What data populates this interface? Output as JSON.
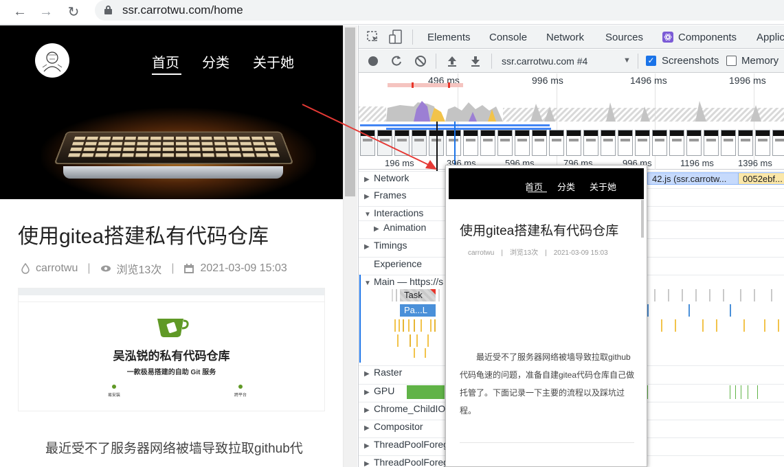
{
  "browser": {
    "back_glyph": "←",
    "forward_glyph": "→",
    "reload_glyph": "↻",
    "url": "ssr.carrotwu.com/home"
  },
  "webpage": {
    "nav": [
      "首页",
      "分类",
      "关于她"
    ],
    "post_title": "使用gitea搭建私有代码仓库",
    "meta": {
      "author": "carrotwu",
      "views": "浏览13次",
      "date": "2021-03-09 15:03",
      "separator": "|"
    },
    "screenshot": {
      "title": "吴泓锐的私有代码仓库",
      "subtitle": "一款极易搭建的自助 Git 服务",
      "feature_left_title": "易安装",
      "feature_right_title": "跨平台"
    },
    "body_first_line": "最近受不了服务器网络被墙导致拉取github代"
  },
  "devtools": {
    "tabs": [
      "Elements",
      "Console",
      "Network",
      "Sources",
      "Components",
      "Applic"
    ],
    "toolbar": {
      "profile_select": "ssr.carrotwu.com #4",
      "dropdown_glyph": "▼",
      "screenshots_label": "Screenshots",
      "screenshots_checked": true,
      "memory_label": "Memory",
      "memory_checked": false
    },
    "overview_ticks": [
      "496 ms",
      "996 ms",
      "1496 ms",
      "1996 ms"
    ],
    "ruler_ticks": [
      "196 ms",
      "396 ms",
      "596 ms",
      "796 ms",
      "996 ms",
      "1196 ms",
      "1396 ms"
    ],
    "tracks": [
      {
        "label": "Network",
        "expanded": false
      },
      {
        "label": "Frames",
        "expanded": false
      },
      {
        "label": "Interactions",
        "expanded": true
      },
      {
        "label": "Animation",
        "expanded": false
      },
      {
        "label": "Timings",
        "expanded": false
      },
      {
        "label": "Experience",
        "expanded": null
      },
      {
        "label": "Main — https://s",
        "expanded": true
      },
      {
        "label": "Raster",
        "expanded": false
      },
      {
        "label": "GPU",
        "expanded": false
      },
      {
        "label": "Chrome_ChildIOT",
        "expanded": false
      },
      {
        "label": "Compositor",
        "expanded": false
      },
      {
        "label": "ThreadPoolForeg",
        "expanded": false
      },
      {
        "label": "ThreadPoolForeg",
        "expanded": false
      }
    ],
    "network_bars": [
      "42.js (ssr.carrotw...",
      "0052ebf..."
    ],
    "main_flames": [
      "Task",
      "Pa...L"
    ],
    "colors": {
      "accent": "#1a73e8",
      "gpu": "#60b347",
      "scripting": "#f2c34a",
      "rendering": "#9c7fd4",
      "task_gray": "#c9c9c9",
      "long_task_red": "#e8352a"
    }
  },
  "popover": {
    "nav": [
      "首页",
      "分类",
      "关于她"
    ],
    "title": "使用gitea搭建私有代码仓库",
    "meta": [
      "carrotwu",
      "|",
      "浏览13次",
      "|",
      "2021-03-09 15:03"
    ],
    "body": "最近受不了服务器网络被墙导致拉取github代码龟速的问题，准备自建gitea代码仓库自己做托管了。下面记录一下主要的流程以及踩坑过程。"
  }
}
